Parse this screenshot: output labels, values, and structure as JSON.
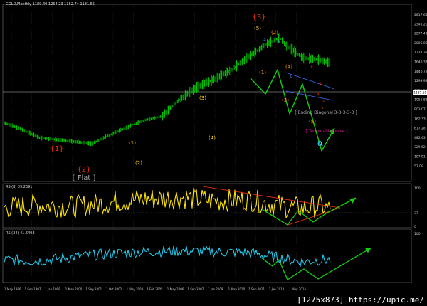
{
  "header": {
    "main": "GOLD,Monthly  1189.40  1264.23  1162.74  1181.55",
    "rsi1": "RSI(8) 39.2391",
    "rsi2": "RSI(34) 41.6493"
  },
  "watermark": "[1275x873] https://upic.me/",
  "colors": {
    "price": "#00e000",
    "rsi1": "#ffe600",
    "rsi2": "#20c8e8",
    "arrow": "#10d010",
    "wave_orange": "#ff9900",
    "wave_yellow": "#ffd200",
    "wave_red": "#ff3010",
    "wave_blue": "#40a0ff",
    "magenta": "#e01090",
    "grid": "#404040"
  },
  "price_axis_labels": [
    "2817.65",
    "2545.20",
    "2277.43",
    "2006.06",
    "1737.39",
    "1646.33",
    "1440.79",
    "1299.99",
    "1181.55",
    "1055.82",
    "903.07",
    "762.33",
    "617.28",
    "482.43",
    "329.62",
    "197.91",
    "57.08"
  ],
  "last_price": "1181.55",
  "rsi1_axis": [
    "100",
    "37",
    "0"
  ],
  "rsi2_axis": [
    "100"
  ],
  "x_axis_labels": [
    "1 May 1996",
    "1 Sep 1997",
    "1 Jan 1999",
    "1 May 2000",
    "1 Sep 2001",
    "1 Oct 2002",
    "1 May 2003",
    "1 Feb 2005",
    "1 May 2006",
    "1 Sep 2007",
    "1 Jan 2009",
    "1 May 2010",
    "1 Sep 2011",
    "1 Jan 2013",
    "1 May 2014"
  ],
  "wave_labels": [
    {
      "text": "{1}",
      "color": "wave_red",
      "size": 10
    },
    {
      "text": "{2}",
      "color": "wave_red",
      "size": 10
    },
    {
      "text": "[ Flat ]",
      "color": "grey",
      "size": 10
    },
    {
      "text": "{3}",
      "color": "wave_red",
      "size": 10
    },
    {
      "text": "(1)",
      "color": "wave_yellow",
      "size": 7
    },
    {
      "text": "(2)",
      "color": "wave_yellow",
      "size": 7
    },
    {
      "text": "(3)",
      "color": "wave_yellow",
      "size": 7
    },
    {
      "text": "(4)",
      "color": "wave_yellow",
      "size": 7
    },
    {
      "text": "(5)",
      "color": "wave_yellow",
      "size": 7
    },
    {
      "text": "(2)",
      "color": "wave_orange",
      "size": 7
    },
    {
      "text": "(1)",
      "color": "wave_orange",
      "size": 7
    },
    {
      "text": "(3)",
      "color": "wave_orange",
      "size": 7
    },
    {
      "text": "(4)",
      "color": "wave_orange",
      "size": 7
    },
    {
      "text": "(5)",
      "color": "wave_orange",
      "size": 7
    },
    {
      "text": "a",
      "color": "wave_blue",
      "size": 6
    },
    {
      "text": "b",
      "color": "wave_blue",
      "size": 6
    },
    {
      "text": "c",
      "color": "wave_blue",
      "size": 6
    },
    {
      "text": "a",
      "color": "wave_red",
      "size": 5
    },
    {
      "text": "b",
      "color": "wave_red",
      "size": 5
    },
    {
      "text": "c",
      "color": "wave_red",
      "size": 5
    },
    {
      "text": "d",
      "color": "wave_red",
      "size": 5
    },
    {
      "text": "e",
      "color": "wave_red",
      "size": 5
    },
    {
      "text": "[ Ending Diagonal 3-3-3-3-3 ]",
      "color": "grey",
      "size": 6
    },
    {
      "text": "[ Terminal impulse ]",
      "color": "magenta",
      "size": 6
    }
  ],
  "chart_data": [
    {
      "type": "line",
      "title": "GOLD,Monthly",
      "x": [
        1996,
        1997,
        1998,
        1999,
        2000,
        2001,
        2002,
        2003,
        2004,
        2005,
        2006,
        2007,
        2008,
        2009,
        2010,
        2011,
        2011.7,
        2012,
        2013,
        2014,
        2014.6
      ],
      "series": [
        {
          "name": "GOLD",
          "values": [
            390,
            345,
            295,
            285,
            275,
            265,
            310,
            360,
            410,
            440,
            600,
            760,
            880,
            1050,
            1350,
            1700,
            1890,
            1650,
            1300,
            1250,
            1181
          ]
        }
      ],
      "ylabel": "",
      "xlabel": ""
    },
    {
      "type": "line",
      "title": "RSI(8) 39.2391",
      "ylim": [
        0,
        100
      ],
      "x": [
        1996,
        1998,
        2000,
        2002,
        2004,
        2006,
        2008,
        2010,
        2011,
        2012,
        2013,
        2014,
        2014.6
      ],
      "series": [
        {
          "name": "RSI(8)",
          "values": [
            45,
            52,
            48,
            58,
            66,
            70,
            62,
            64,
            55,
            48,
            44,
            50,
            39
          ]
        }
      ]
    },
    {
      "type": "line",
      "title": "RSI(34) 41.6493",
      "ylim": [
        0,
        100
      ],
      "x": [
        1996,
        1998,
        2000,
        2002,
        2004,
        2006,
        2008,
        2010,
        2011,
        2012,
        2013,
        2014,
        2014.6
      ],
      "series": [
        {
          "name": "RSI(34)",
          "values": [
            42,
            40,
            48,
            54,
            58,
            60,
            58,
            56,
            50,
            44,
            38,
            42,
            42
          ]
        }
      ]
    }
  ]
}
